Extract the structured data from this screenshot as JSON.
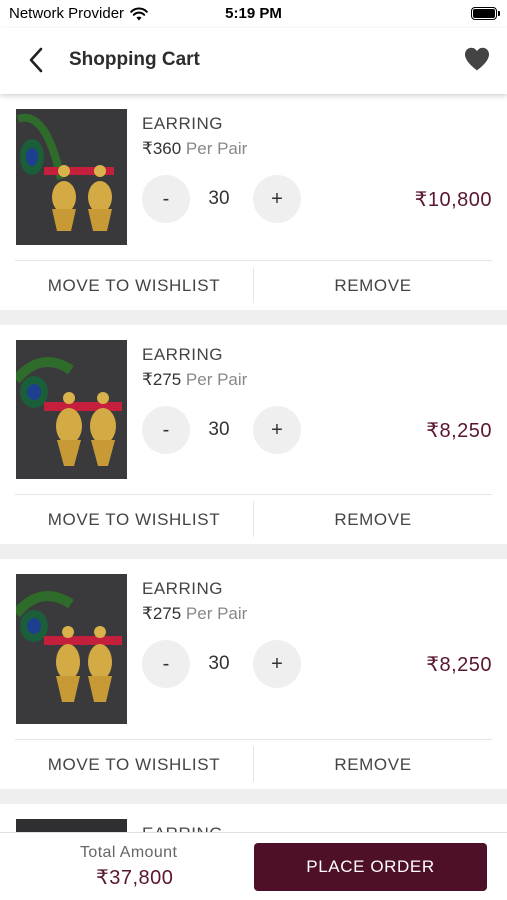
{
  "status_bar": {
    "carrier": "Network Provider",
    "time": "5:19 PM"
  },
  "header": {
    "title": "Shopping Cart",
    "back_icon": "chevron-left-icon",
    "wishlist_icon": "heart-icon"
  },
  "cart_items": [
    {
      "name": "EARRING",
      "price": "₹360",
      "unit": " Per Pair",
      "minus": "-",
      "quantity": "30",
      "plus": "+",
      "total": "₹10,800",
      "move_label": "MOVE TO WISHLIST",
      "remove_label": "REMOVE"
    },
    {
      "name": "EARRING",
      "price": "₹275",
      "unit": " Per Pair",
      "minus": "-",
      "quantity": "30",
      "plus": "+",
      "total": "₹8,250",
      "move_label": "MOVE TO WISHLIST",
      "remove_label": "REMOVE"
    },
    {
      "name": "EARRING",
      "price": "₹275",
      "unit": " Per Pair",
      "minus": "-",
      "quantity": "30",
      "plus": "+",
      "total": "₹8,250",
      "move_label": "MOVE TO WISHLIST",
      "remove_label": "REMOVE"
    },
    {
      "name": "EARRING"
    }
  ],
  "footer": {
    "total_label": "Total Amount",
    "total_amount": "₹37,800",
    "place_order_label": "PLACE ORDER"
  },
  "colors": {
    "accent": "#4e0f29",
    "price_text": "#5a1632",
    "background": "#efefef"
  }
}
